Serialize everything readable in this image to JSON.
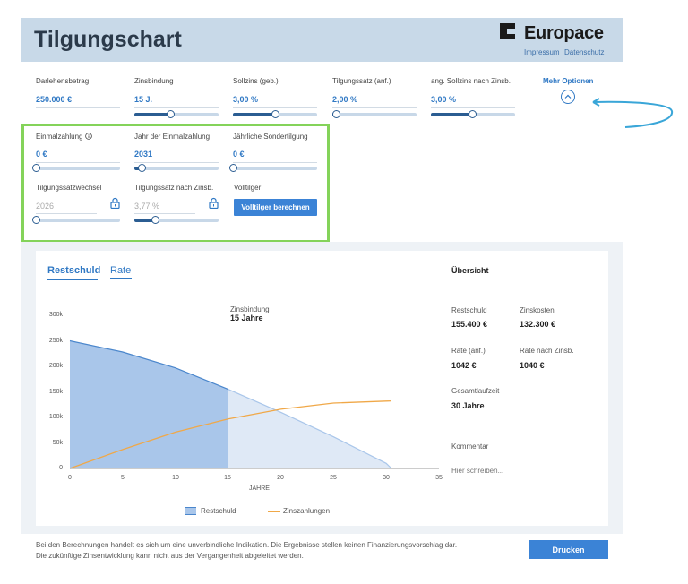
{
  "header": {
    "title": "Tilgungschart",
    "brand": "Europace",
    "links": [
      "Impressum",
      "Datenschutz"
    ]
  },
  "params": [
    {
      "label": "Darlehensbetrag",
      "value": "250.000 €",
      "slider": null
    },
    {
      "label": "Zinsbindung",
      "value": "15 J.",
      "slider": 0.43
    },
    {
      "label": "Sollzins (geb.)",
      "value": "3,00 %",
      "slider": 0.5
    },
    {
      "label": "Tilgungssatz (anf.)",
      "value": "2,00 %",
      "slider": 0.04
    },
    {
      "label": "ang. Sollzins nach Zinsb.",
      "value": "3,00 %",
      "slider": 0.49
    }
  ],
  "more_options": {
    "label": "Mehr Optionen",
    "icon": "chevron-up-icon"
  },
  "options": {
    "einmalzahlung": {
      "label": "Einmalzahlung",
      "info_icon": "info-icon",
      "value": "0 €",
      "slider": 0.0
    },
    "jahr_einmalzahlung": {
      "label": "Jahr der Einmalzahlung",
      "value": "2031",
      "slider": 0.08
    },
    "sondertilgung": {
      "label": "Jährliche Sondertilgung",
      "value": "0 €",
      "slider": 0.0
    },
    "tilgungssatzwechsel": {
      "label": "Tilgungssatzwechsel",
      "value": "2026",
      "slider": 0.0,
      "icon": "lock-icon"
    },
    "tilgungssatz_nach": {
      "label": "Tilgungssatz nach Zinsb.",
      "value": "3,77 %",
      "slider": 0.24,
      "icon": "lock-icon"
    },
    "volltilger": {
      "label": "Volltilger",
      "button": "Volltilger berechnen"
    }
  },
  "tabs": {
    "active": "Restschuld",
    "other": "Rate"
  },
  "chart_data": {
    "type": "area",
    "xlabel": "JAHRE",
    "ylabel": "",
    "x_ticks": [
      0,
      5,
      10,
      15,
      20,
      25,
      30,
      35
    ],
    "y_ticks": [
      "0",
      "50k",
      "100k",
      "150k",
      "200k",
      "250k",
      "300k"
    ],
    "xlim": [
      0,
      35
    ],
    "ylim": [
      0,
      300000
    ],
    "annotation": {
      "x": 15,
      "line1": "Zinsbindung",
      "line2": "15 Jahre"
    },
    "series": [
      {
        "name": "Restschuld",
        "color": "#4a86cc",
        "x": [
          0,
          5,
          10,
          15,
          20,
          25,
          30,
          30.5
        ],
        "y": [
          250000,
          228000,
          197000,
          155000,
          110000,
          62000,
          10000,
          0
        ]
      },
      {
        "name": "Zinszahlungen",
        "color": "#f0a848",
        "x": [
          0,
          5,
          10,
          15,
          20,
          25,
          30,
          30.5
        ],
        "y": [
          0,
          37000,
          71000,
          97000,
          116000,
          128000,
          132000,
          132300
        ]
      }
    ],
    "legend": "bottom"
  },
  "summary": {
    "title": "Übersicht",
    "items": [
      {
        "label": "Restschuld",
        "value": "155.400 €"
      },
      {
        "label": "Zinskosten",
        "value": "132.300 €"
      },
      {
        "label": "Rate (anf.)",
        "value": "1042 €"
      },
      {
        "label": "Rate nach Zinsb.",
        "value": "1040 €"
      },
      {
        "label": "Gesamtlaufzeit",
        "value": "30 Jahre"
      }
    ],
    "comment_label": "Kommentar",
    "comment_placeholder": "Hier schreiben..."
  },
  "footer": {
    "disclaimer_1": "Bei den Berechnungen handelt es sich um eine unverbindliche Indikation. Die Ergebnisse stellen keinen Finanzierungsvorschlag dar.",
    "disclaimer_2": "Die zukünftige Zinsentwicklung kann nicht aus der Vergangenheit abgeleitet werden.",
    "print_button": "Drucken"
  },
  "colors": {
    "accent": "#2f78c4",
    "highlight_box": "#84d35a",
    "header_bg": "#c8d9e8"
  }
}
